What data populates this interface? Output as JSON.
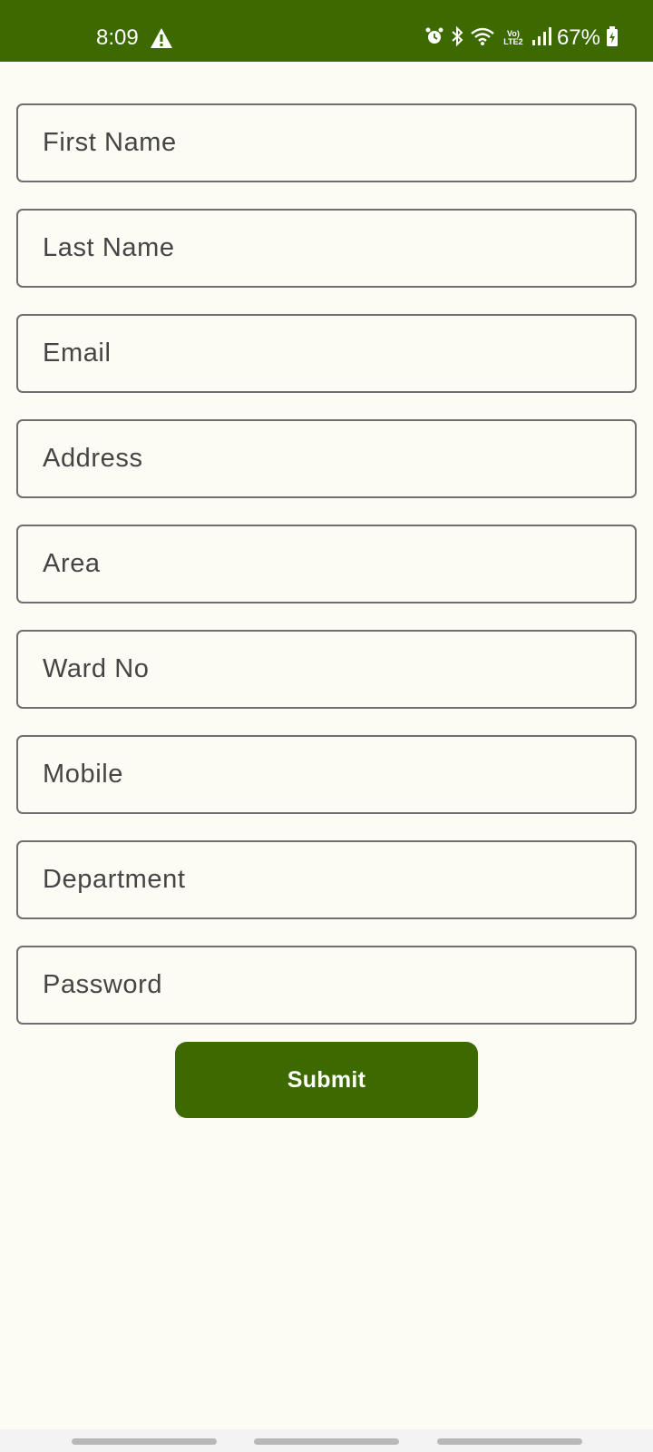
{
  "status_bar": {
    "time": "8:09",
    "battery": "67%",
    "network_label": "Vo) LTE2",
    "background_color": "#3c6900",
    "icons": [
      "warning-icon",
      "alarm-icon",
      "bluetooth-icon",
      "wifi-icon",
      "lte-icon",
      "signal-icon",
      "battery-icon"
    ]
  },
  "form": {
    "fields": [
      {
        "placeholder": "First Name"
      },
      {
        "placeholder": "Last Name"
      },
      {
        "placeholder": "Email"
      },
      {
        "placeholder": "Address"
      },
      {
        "placeholder": "Area"
      },
      {
        "placeholder": "Ward No"
      },
      {
        "placeholder": "Mobile"
      },
      {
        "placeholder": "Department"
      },
      {
        "placeholder": "Password"
      }
    ],
    "submit_label": "Submit",
    "accent_color": "#3c6900"
  }
}
